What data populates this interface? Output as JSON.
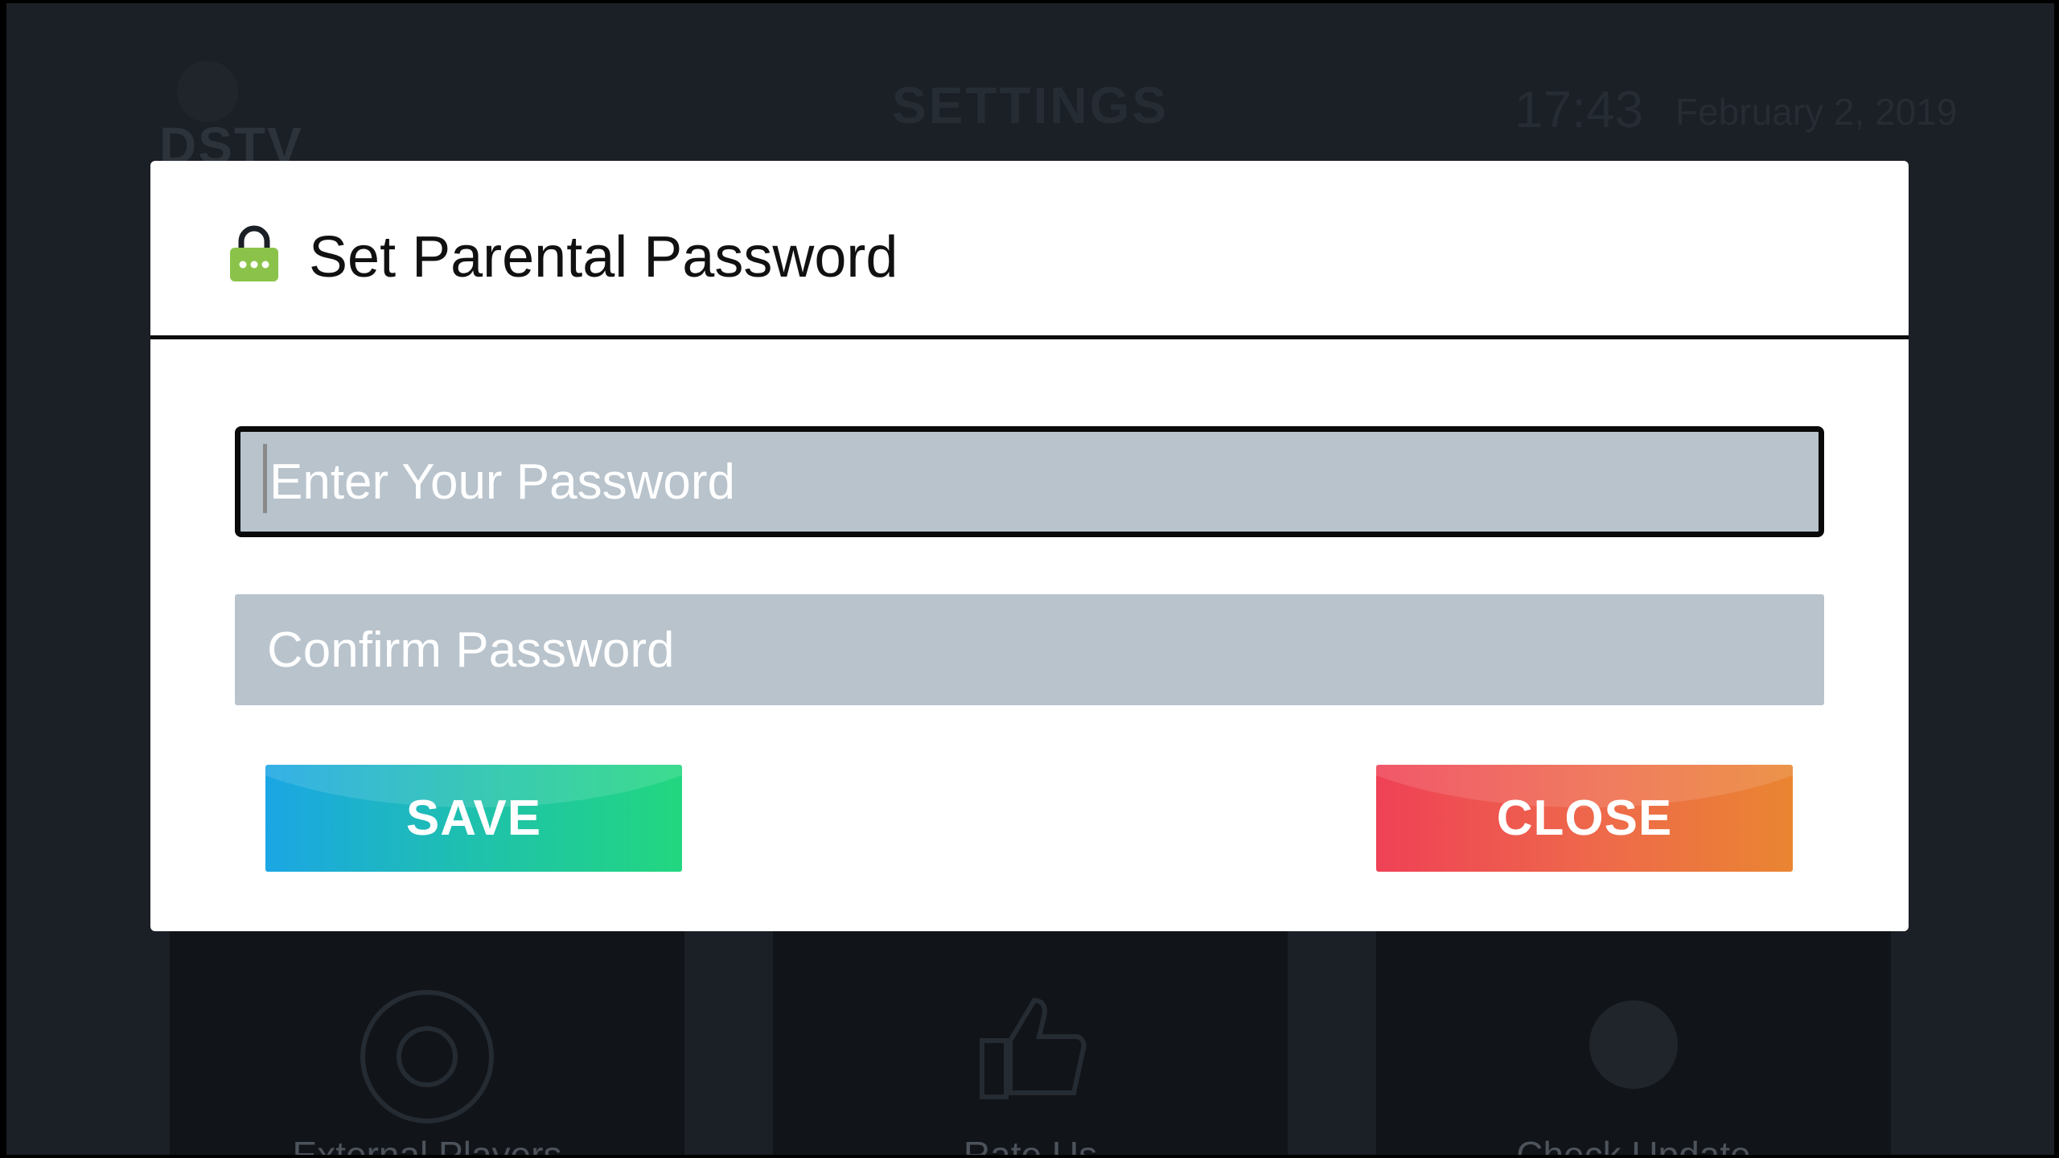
{
  "background": {
    "logo_text": "DSTV",
    "page_title": "SETTINGS",
    "time": "17:43",
    "date": "February 2, 2019",
    "cards": [
      {
        "label": "External Players",
        "icon": "external-player-icon"
      },
      {
        "label": "Rate Us",
        "icon": "thumbs-up-icon"
      },
      {
        "label": "Check Update",
        "icon": "update-icon"
      }
    ]
  },
  "dialog": {
    "title": "Set Parental Password",
    "icon": "lock-icon",
    "password": {
      "value": "",
      "placeholder": "Enter Your Password"
    },
    "confirm": {
      "value": "",
      "placeholder": "Confirm Password"
    },
    "save_label": "SAVE",
    "close_label": "CLOSE"
  },
  "colors": {
    "lock_icon": "#8bc34a",
    "field_bg": "#b8c3cc",
    "save_gradient": [
      "#1ba6e4",
      "#22d77f"
    ],
    "close_gradient": [
      "#ef4156",
      "#ea8531"
    ]
  }
}
